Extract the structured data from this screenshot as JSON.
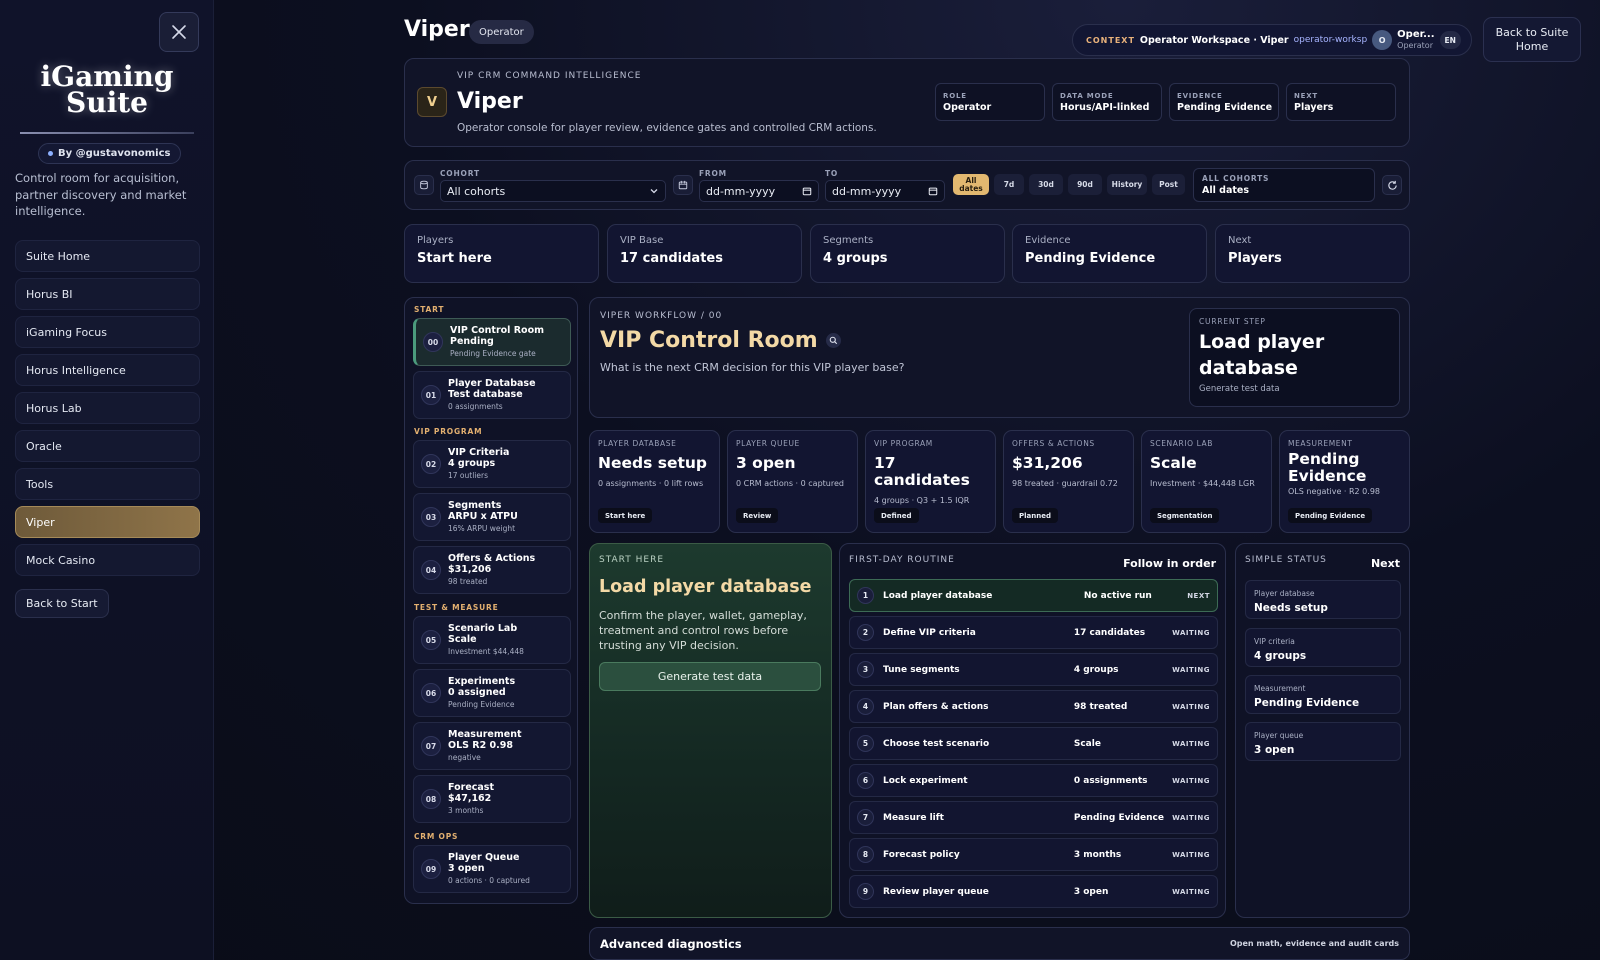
{
  "sidebar": {
    "brand_line1": "iGaming",
    "brand_line2": "Suite",
    "byline": "By @gustavonomics",
    "tagline": "Control room for acquisition, partner discovery and market intelligence.",
    "items": [
      {
        "label": "Suite Home"
      },
      {
        "label": "Horus BI"
      },
      {
        "label": "iGaming Focus"
      },
      {
        "label": "Horus Intelligence"
      },
      {
        "label": "Horus Lab"
      },
      {
        "label": "Oracle"
      },
      {
        "label": "Tools"
      },
      {
        "label": "Viper",
        "active": true
      },
      {
        "label": "Mock Casino"
      }
    ],
    "back_to_start": "Back to Start"
  },
  "header": {
    "title": "Viper",
    "role_pill": "Operator",
    "context_label": "CONTEXT",
    "context_main": "Operator Workspace · Viper",
    "context_id": "operator-worksp",
    "avatar_initial": "O",
    "user_name": "Oper...",
    "user_role": "Operator",
    "lang": "EN",
    "back_suite": "Back to Suite Home"
  },
  "hero": {
    "logo": "V",
    "kicker": "VIP CRM COMMAND INTELLIGENCE",
    "title": "Viper",
    "subtitle": "Operator console for player review, evidence gates and controlled CRM actions.",
    "tags": [
      {
        "k": "ROLE",
        "v": "Operator"
      },
      {
        "k": "DATA MODE",
        "v": "Horus/API-linked"
      },
      {
        "k": "EVIDENCE",
        "v": "Pending Evidence"
      },
      {
        "k": "NEXT",
        "v": "Players"
      }
    ]
  },
  "filter": {
    "cohort_label": "COHORT",
    "cohort_value": "All cohorts",
    "from_label": "FROM",
    "from_value": "dd-mm-yyyy",
    "to_label": "TO",
    "to_value": "dd-mm-yyyy",
    "chips": [
      "All dates",
      "7d",
      "30d",
      "90d",
      "History",
      "Post"
    ],
    "summary_label": "ALL COHORTS",
    "summary_value": "All dates"
  },
  "kpis": [
    {
      "k": "Players",
      "v": "Start here"
    },
    {
      "k": "VIP Base",
      "v": "17 candidates"
    },
    {
      "k": "Segments",
      "v": "4 groups"
    },
    {
      "k": "Evidence",
      "v": "Pending Evidence"
    },
    {
      "k": "Next",
      "v": "Players"
    }
  ],
  "steps": {
    "sections": [
      "START",
      "VIP PROGRAM",
      "TEST & MEASURE",
      "CRM OPS"
    ],
    "items": [
      {
        "n": "00",
        "t": "VIP Control Room",
        "v": "Pending",
        "s": "Pending Evidence gate"
      },
      {
        "n": "01",
        "t": "Player Database",
        "v": "Test database",
        "s": "0 assignments"
      },
      {
        "n": "02",
        "t": "VIP Criteria",
        "v": "4 groups",
        "s": "17 outliers"
      },
      {
        "n": "03",
        "t": "Segments",
        "v": "ARPU x ATPU",
        "s": "16% ARPU weight"
      },
      {
        "n": "04",
        "t": "Offers & Actions",
        "v": "$31,206",
        "s": "98 treated"
      },
      {
        "n": "05",
        "t": "Scenario Lab",
        "v": "Scale",
        "s": "Investment $44,448"
      },
      {
        "n": "06",
        "t": "Experiments",
        "v": "0 assigned",
        "s": "Pending Evidence"
      },
      {
        "n": "07",
        "t": "Measurement",
        "v": "OLS R2 0.98",
        "s": "negative"
      },
      {
        "n": "08",
        "t": "Forecast",
        "v": "$47,162",
        "s": "3 months"
      },
      {
        "n": "09",
        "t": "Player Queue",
        "v": "3 open",
        "s": "0 actions · 0 captured"
      }
    ]
  },
  "workflow": {
    "kicker": "VIPER WORKFLOW / 00",
    "title": "VIP Control Room",
    "question": "What is the next CRM decision for this VIP player base?",
    "current_label": "CURRENT STEP",
    "current_title": "Load player database",
    "current_sub": "Generate test data"
  },
  "metrics": [
    {
      "k": "PLAYER DATABASE",
      "v": "Needs setup",
      "s": "0 assignments · 0 lift rows",
      "b": "Start here"
    },
    {
      "k": "PLAYER QUEUE",
      "v": "3 open",
      "s": "0 CRM actions · 0 captured",
      "b": "Review"
    },
    {
      "k": "VIP PROGRAM",
      "v": "17 candidates",
      "s": "4 groups · Q3 + 1.5 IQR",
      "b": "Defined"
    },
    {
      "k": "OFFERS & ACTIONS",
      "v": "$31,206",
      "s": "98 treated · guardrail 0.72",
      "b": "Planned"
    },
    {
      "k": "SCENARIO LAB",
      "v": "Scale",
      "s": "Investment · $44,448 LGR",
      "b": "Segmentation"
    },
    {
      "k": "MEASUREMENT",
      "v": "Pending Evidence",
      "s": "OLS negative · R2 0.98",
      "b": "Pending Evidence"
    }
  ],
  "start_here": {
    "kicker": "START HERE",
    "title": "Load player database",
    "desc": "Confirm the player, wallet, gameplay, treatment and control rows before trusting any VIP decision.",
    "button": "Generate test data"
  },
  "routine": {
    "kicker": "FIRST-DAY ROUTINE",
    "hint": "Follow in order",
    "rows": [
      {
        "n": "1",
        "t": "Load player database",
        "v": "No active run",
        "s": "NEXT"
      },
      {
        "n": "2",
        "t": "Define VIP criteria",
        "v": "17 candidates",
        "s": "WAITING"
      },
      {
        "n": "3",
        "t": "Tune segments",
        "v": "4 groups",
        "s": "WAITING"
      },
      {
        "n": "4",
        "t": "Plan offers & actions",
        "v": "98 treated",
        "s": "WAITING"
      },
      {
        "n": "5",
        "t": "Choose test scenario",
        "v": "Scale",
        "s": "WAITING"
      },
      {
        "n": "6",
        "t": "Lock experiment",
        "v": "0 assignments",
        "s": "WAITING"
      },
      {
        "n": "7",
        "t": "Measure lift",
        "v": "Pending Evidence",
        "s": "WAITING"
      },
      {
        "n": "8",
        "t": "Forecast policy",
        "v": "3 months",
        "s": "WAITING"
      },
      {
        "n": "9",
        "t": "Review player queue",
        "v": "3 open",
        "s": "WAITING"
      }
    ]
  },
  "status": {
    "kicker": "SIMPLE STATUS",
    "hint": "Next",
    "items": [
      {
        "a": "Player database",
        "b": "Needs setup"
      },
      {
        "a": "VIP criteria",
        "b": "4 groups"
      },
      {
        "a": "Measurement",
        "b": "Pending Evidence"
      },
      {
        "a": "Player queue",
        "b": "3 open"
      }
    ]
  },
  "diagnostics": {
    "title": "Advanced diagnostics",
    "sub": "Open math, evidence and audit cards"
  }
}
